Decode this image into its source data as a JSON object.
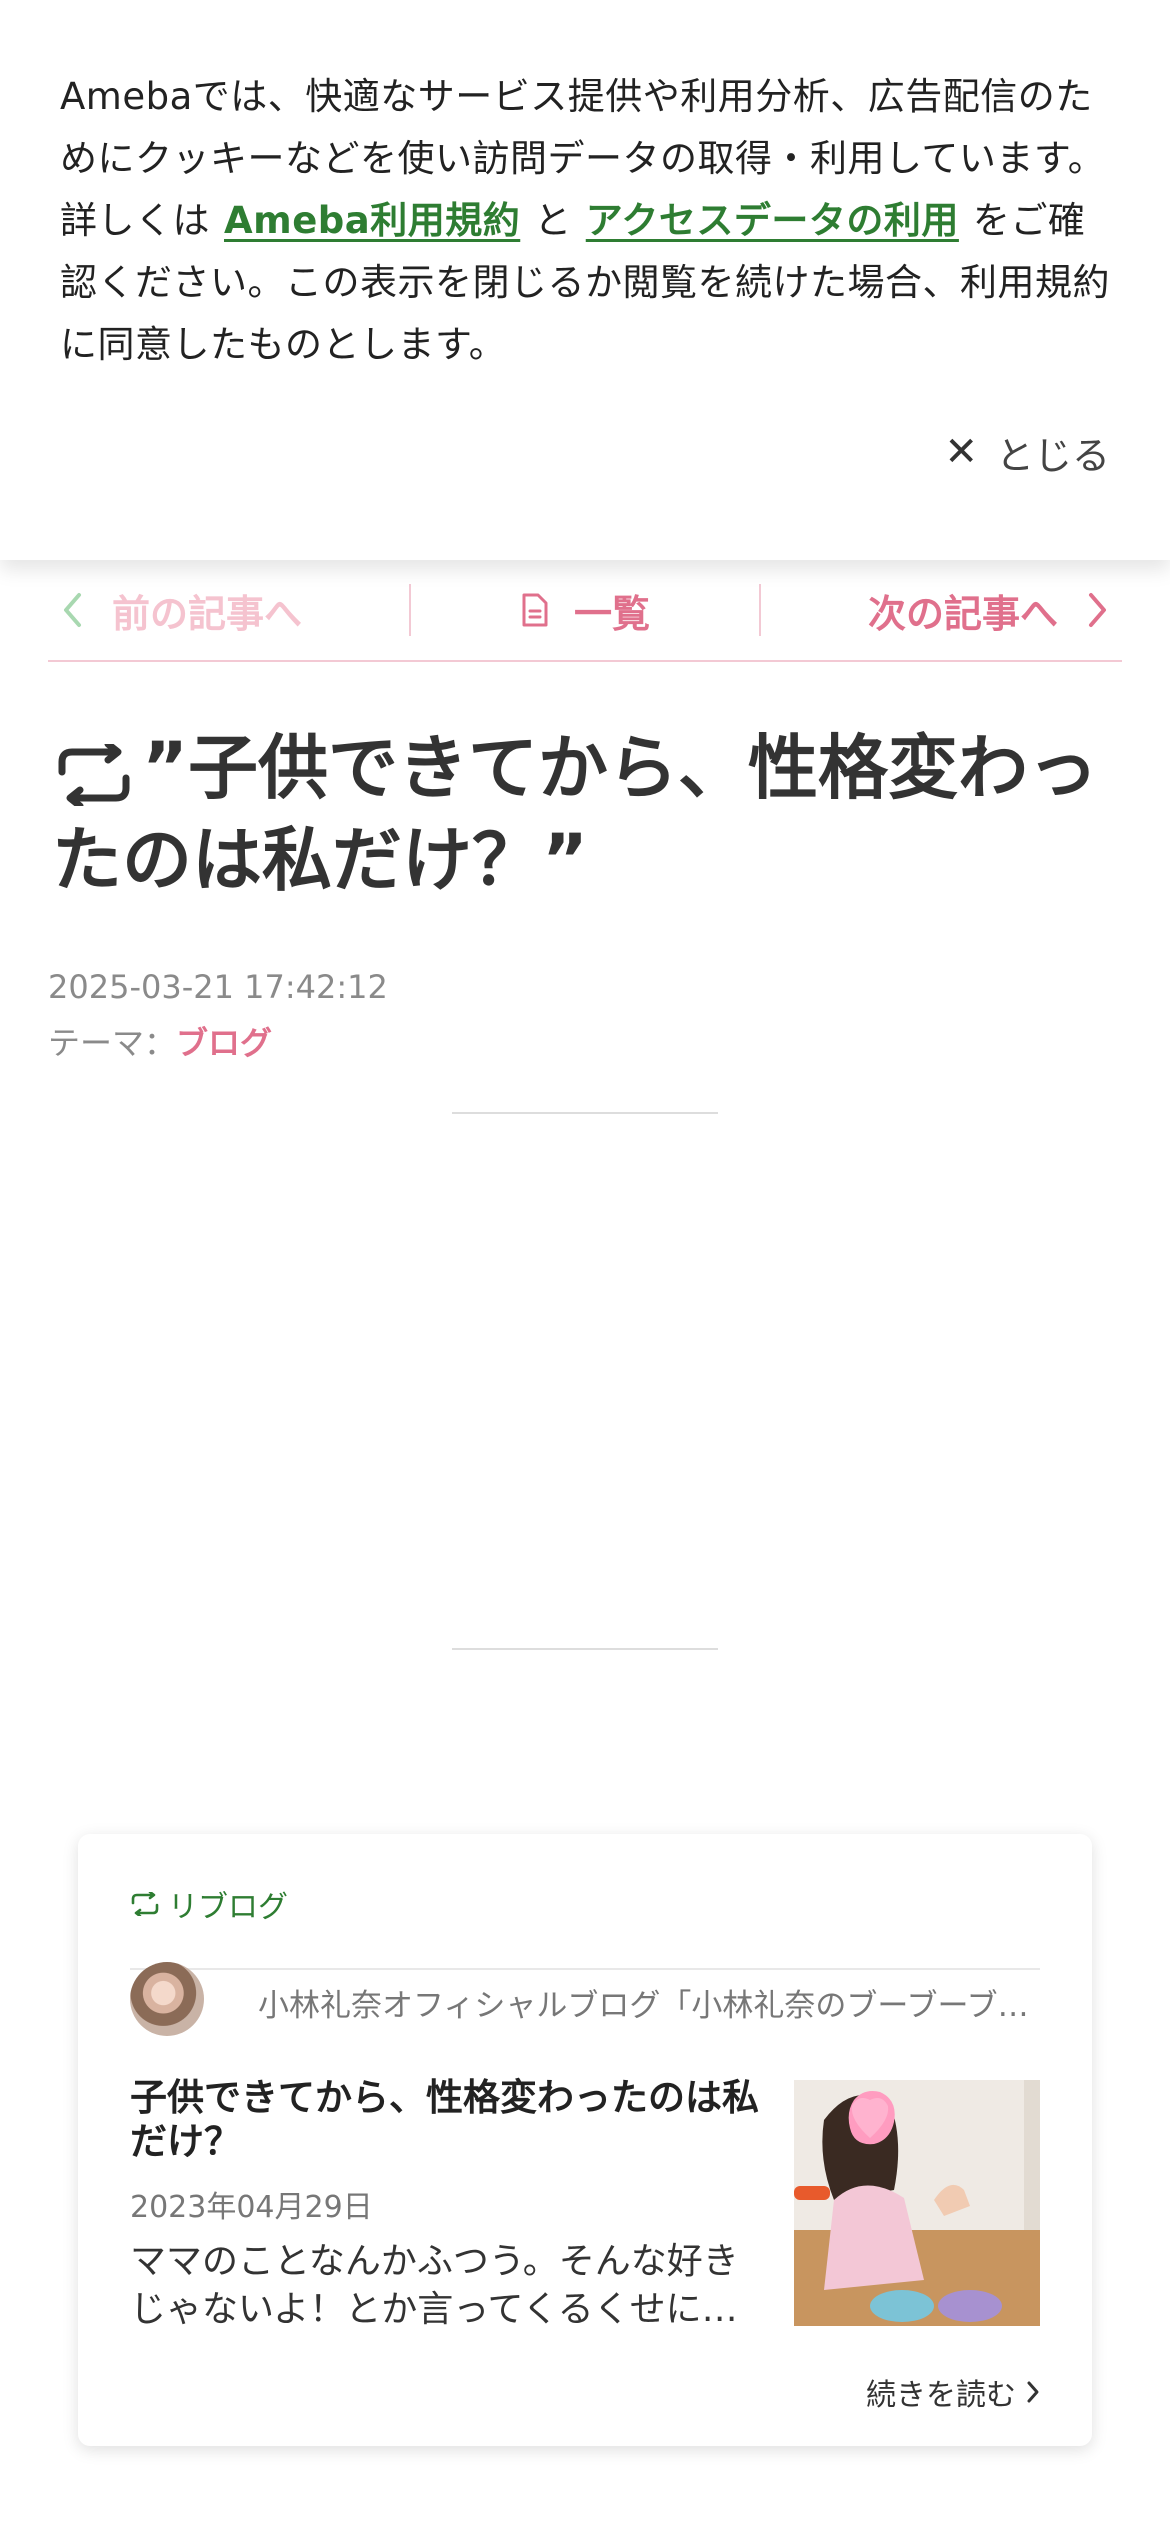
{
  "cookie_banner": {
    "text_before": "Amebaでは、快適なサービス提供や利用分析、広告配信のためにクッキーなどを使い訪問データの取得・利用しています。詳しくは",
    "link_terms": "Ameba利用規約",
    "connector": "と",
    "link_access": "アクセスデータの利用",
    "text_after": "をご確認ください。この表示を閉じるか閲覧を続けた場合、利用規約に同意したものとします。",
    "close_label": "とじる"
  },
  "nav": {
    "prev_label": "前の記事へ",
    "list_label": "一覧",
    "next_label": "次の記事へ"
  },
  "article": {
    "title": "”子供できてから、性格変わったのは私だけ？”",
    "date": "2025-03-21 17:42:12",
    "theme_label": "テーマ：",
    "theme_value": "ブログ"
  },
  "reblog_card": {
    "header_label": "リブログ",
    "blog_name": "小林礼奈オフィシャルブログ「小林礼奈のブーブーブログ」",
    "title": "子供できてから、性格変わったのは私だけ？",
    "date": "2023年04月29日",
    "excerpt": "ママのことなんかふつう。そんな好きじゃないよ！とか言ってくるくせに…",
    "read_more": "続きを読む"
  },
  "colors": {
    "accent_pink": "#e0708c",
    "link_green": "#2e7d32"
  }
}
